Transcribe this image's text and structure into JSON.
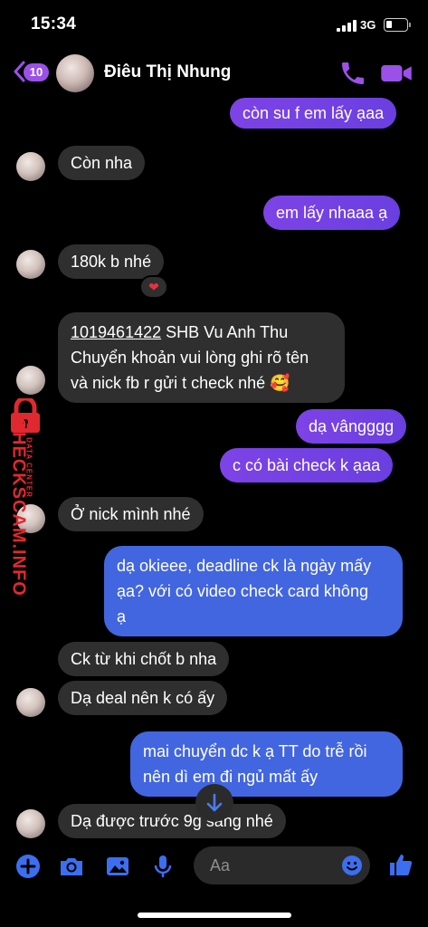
{
  "status_bar": {
    "time": "15:34",
    "network": "3G",
    "battery_level": 0.3
  },
  "header": {
    "back_count": "10",
    "contact_name": "Điêu Thị Nhung"
  },
  "messages": [
    {
      "text": "còn su f em lấy ạaa"
    },
    {
      "text": "Còn nha"
    },
    {
      "text": "em lấy nhaaa ạ"
    },
    {
      "text": "180k b nhé",
      "reaction": "❤"
    },
    {
      "account": "1019461422",
      "line1_rest": " SHB Vu Anh Thu",
      "line2": "Chuyển khoản vui lòng ghi rõ tên",
      "line3": "và nick fb r gửi t check nhé 🥰"
    },
    {
      "text": "dạ vângggg"
    },
    {
      "text": "c có bài check k ạaa"
    },
    {
      "text": "Ở nick mình nhé"
    },
    {
      "line1": "dạ okieee, deadline ck là ngày mấy",
      "line2": "ạa? với có video check card không",
      "line3": "ạ"
    },
    {
      "text": "Ck từ khi chốt b nha"
    },
    {
      "text": "Dạ deal nên k có ấy"
    },
    {
      "line1": "mai chuyển dc k ạ TT do trễ rồi",
      "line2": "nên dì em đi ngủ mất ấy"
    },
    {
      "text": "Dạ được trước 9g sang nhé"
    }
  ],
  "watermark": {
    "main": "CHECKSCAM.INFO",
    "sub": "DATA CENTER"
  },
  "composer": {
    "placeholder": "Aa"
  },
  "colors": {
    "outgoing": "#7d43e6",
    "outgoing_blue": "#4266e0",
    "incoming": "#2f2f2f",
    "accent": "#9b51e8",
    "watermark": "#e0292f"
  }
}
